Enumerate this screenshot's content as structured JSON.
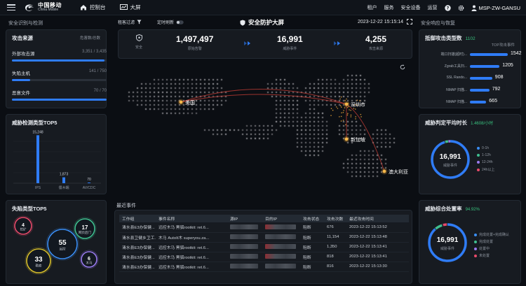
{
  "header": {
    "logo_cn": "中国移动",
    "logo_en": "China Mobile",
    "nav": [
      {
        "label": "控制台"
      },
      {
        "label": "大屏"
      }
    ],
    "right_nav": [
      {
        "label": "租户"
      },
      {
        "label": "服务"
      },
      {
        "label": "安全设备"
      },
      {
        "label": "运营"
      }
    ],
    "user": "MSP-ZW-GANSU"
  },
  "left_section_title": "安全识别与检测",
  "right_section_title": "安全响应与恢复",
  "attack_source": {
    "title": "攻击来源",
    "subtitle": "危害数/总数",
    "rows": [
      {
        "label": "外部攻击源",
        "value": "3,351 / 3,435",
        "fill": 0.976
      },
      {
        "label": "失陷主机",
        "value": "141 / 750",
        "fill": 0.19
      },
      {
        "label": "恶意文件",
        "value": "70 / 70",
        "fill": 1.0
      }
    ]
  },
  "threat_types": {
    "title": "威胁检测类型TOP5",
    "chart_data": {
      "type": "bar",
      "categories": [
        "IPS",
        "僵木蠕",
        "AV/CDC"
      ],
      "values": [
        15248,
        1873,
        70
      ],
      "value_labels": [
        "15,248",
        "1,873",
        "70"
      ],
      "ylim": [
        0,
        16000
      ]
    }
  },
  "loss_types": {
    "title": "失陷类型TOP5",
    "bubbles": [
      {
        "num": "4",
        "label": "挖矿",
        "color": "#e84a6a"
      },
      {
        "num": "17",
        "label": "网页后门",
        "color": "#3fbf8f"
      },
      {
        "num": "55",
        "label": "远控",
        "color": "#3a8ef5"
      },
      {
        "num": "33",
        "label": "勒索",
        "color": "#d9c02a"
      },
      {
        "num": "6",
        "label": "木马",
        "color": "#9a7bf0"
      }
    ]
  },
  "center": {
    "filter1": "租客过滤",
    "filter2": "定时刷新",
    "title": "安全防护大屏",
    "datetime": "2023-12-22 15:15:14",
    "stats": [
      {
        "label": "安全",
        "value": ""
      },
      {
        "label": "原始告警",
        "value": "1,497,497"
      },
      {
        "label": "威胁事件",
        "value": "16,991"
      },
      {
        "label": "攻击来源",
        "value": "4,255"
      }
    ],
    "map_labels": [
      {
        "text": "美国"
      },
      {
        "text": "深圳市"
      },
      {
        "text": "新加坡"
      },
      {
        "text": "澳大利亚"
      }
    ]
  },
  "events": {
    "title": "最近事件",
    "columns": [
      "工作组",
      "事件名称",
      "源IP",
      "目的IP",
      "攻击状态",
      "攻击次数",
      "最近攻击时间"
    ],
    "rows": [
      {
        "group": "清水县E3办保健...",
        "name": "远控木马 黑狐rootkit: ret.6...",
        "status": "阻断",
        "count": "676",
        "time": "2023-12-22 15:13:52"
      },
      {
        "group": "清水县卫健乡卫工...",
        "name": "木马 AutoIt木 superyou.za...",
        "status": "阻断",
        "count": "11,154",
        "time": "2023-12-22 15:13:48"
      },
      {
        "group": "清水县E3办保健...",
        "name": "远控木马 黑狐rootkit: ret.6...",
        "status": "阻断",
        "count": "1,350",
        "time": "2023-12-22 15:13:41"
      },
      {
        "group": "清水县E3办保健...",
        "name": "远控木马 黑狐rootkit: ret.6...",
        "status": "阻断",
        "count": "818",
        "time": "2023-12-22 15:13:41"
      },
      {
        "group": "清水县E3办保健...",
        "name": "远控木马 黑狐rootkit: ret.6...",
        "status": "阻断",
        "count": "816",
        "time": "2023-12-22 15:13:30"
      }
    ]
  },
  "blocked_types": {
    "title": "抵御攻击类型数",
    "count": "1102",
    "subtitle": "TOP攻击事件",
    "chart_data": {
      "type": "bar",
      "categories": [
        "端口扫描(超时)...",
        "Zgrab工具扫...",
        "SSL Rando...",
        "NMAP 扫描...",
        "NMAP 扫描..."
      ],
      "values": [
        1542,
        1205,
        908,
        792,
        665
      ],
      "value_labels": [
        "1542",
        "1205",
        "908",
        "792",
        "665"
      ]
    }
  },
  "response_time": {
    "title": "威胁判定平均时长",
    "highlight": "1.4608/小时",
    "center_num": "16,991",
    "center_label": "威胁事件",
    "legend": [
      {
        "label": "0-1h",
        "color": "#3a8ef5"
      },
      {
        "label": "1-12h",
        "color": "#3fbf8f"
      },
      {
        "label": "12-24h",
        "color": "#9a7bf0"
      },
      {
        "label": "24h以上",
        "color": "#e84a6a"
      }
    ]
  },
  "handle_rate": {
    "title": "威胁综合处置率",
    "highlight": "94.92%",
    "center_num": "16,991",
    "center_label": "威胁事件",
    "legend": [
      {
        "label": "完成处置+完成确认",
        "color": "#3a8ef5"
      },
      {
        "label": "完成处置",
        "color": "#3fbf8f"
      },
      {
        "label": "处置中",
        "color": "#9a7bf0"
      },
      {
        "label": "未处置",
        "color": "#e84a6a"
      }
    ]
  }
}
